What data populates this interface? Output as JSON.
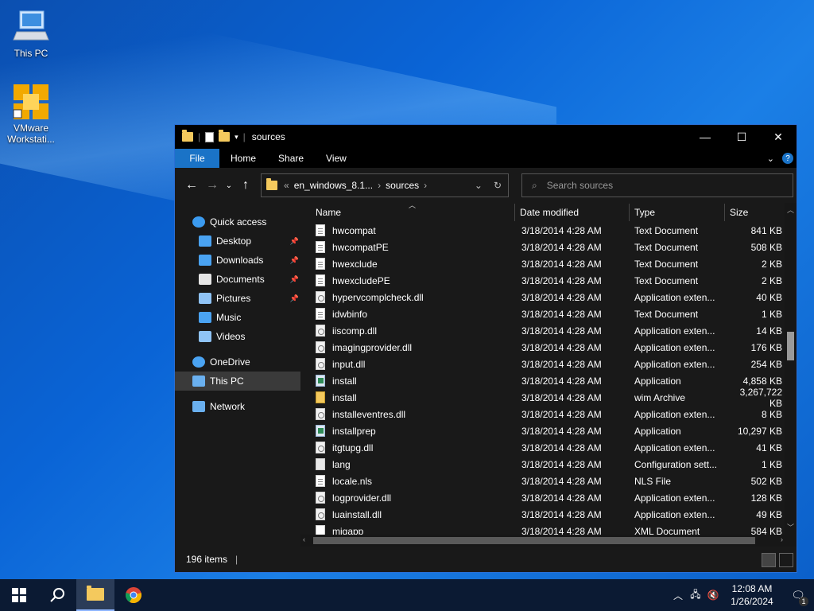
{
  "desktop": {
    "icons": [
      {
        "label": "This PC"
      },
      {
        "label": "VMware Workstati..."
      }
    ]
  },
  "window": {
    "title": "sources",
    "controls": {
      "minimize": "—",
      "maximize": "☐",
      "close": "✕"
    },
    "ribbon_tabs": [
      "File",
      "Home",
      "Share",
      "View"
    ],
    "help_label": "?",
    "address": {
      "parent": "en_windows_8.1...",
      "current": "sources",
      "prefix": "«"
    },
    "search": {
      "placeholder": "Search sources"
    },
    "nav": [
      {
        "label": "Quick access",
        "icon": "star-icon",
        "pinned": false
      },
      {
        "label": "Desktop",
        "icon": "desktop-icon",
        "pinned": true
      },
      {
        "label": "Downloads",
        "icon": "downloads-icon",
        "pinned": true
      },
      {
        "label": "Documents",
        "icon": "documents-icon",
        "pinned": true
      },
      {
        "label": "Pictures",
        "icon": "pictures-icon",
        "pinned": true
      },
      {
        "label": "Music",
        "icon": "music-icon",
        "pinned": false
      },
      {
        "label": "Videos",
        "icon": "videos-icon",
        "pinned": false
      },
      {
        "label": "OneDrive",
        "icon": "onedrive-icon",
        "pinned": false
      },
      {
        "label": "This PC",
        "icon": "computer-icon",
        "pinned": false
      },
      {
        "label": "Network",
        "icon": "network-icon",
        "pinned": false
      }
    ],
    "columns": {
      "name": "Name",
      "date": "Date modified",
      "type": "Type",
      "size": "Size"
    },
    "files": [
      {
        "name": "hwcompat",
        "date": "3/18/2014 4:28 AM",
        "type": "Text Document",
        "size": "841 KB",
        "icon": "txt"
      },
      {
        "name": "hwcompatPE",
        "date": "3/18/2014 4:28 AM",
        "type": "Text Document",
        "size": "508 KB",
        "icon": "txt"
      },
      {
        "name": "hwexclude",
        "date": "3/18/2014 4:28 AM",
        "type": "Text Document",
        "size": "2 KB",
        "icon": "txt"
      },
      {
        "name": "hwexcludePE",
        "date": "3/18/2014 4:28 AM",
        "type": "Text Document",
        "size": "2 KB",
        "icon": "txt"
      },
      {
        "name": "hypervcomplcheck.dll",
        "date": "3/18/2014 4:28 AM",
        "type": "Application exten...",
        "size": "40 KB",
        "icon": "dll"
      },
      {
        "name": "idwbinfo",
        "date": "3/18/2014 4:28 AM",
        "type": "Text Document",
        "size": "1 KB",
        "icon": "txt"
      },
      {
        "name": "iiscomp.dll",
        "date": "3/18/2014 4:28 AM",
        "type": "Application exten...",
        "size": "14 KB",
        "icon": "dll"
      },
      {
        "name": "imagingprovider.dll",
        "date": "3/18/2014 4:28 AM",
        "type": "Application exten...",
        "size": "176 KB",
        "icon": "dll"
      },
      {
        "name": "input.dll",
        "date": "3/18/2014 4:28 AM",
        "type": "Application exten...",
        "size": "254 KB",
        "icon": "dll"
      },
      {
        "name": "install",
        "date": "3/18/2014 4:28 AM",
        "type": "Application",
        "size": "4,858 KB",
        "icon": "app"
      },
      {
        "name": "install",
        "date": "3/18/2014 4:28 AM",
        "type": "wim Archive",
        "size": "3,267,722 KB",
        "icon": "wim"
      },
      {
        "name": "installeventres.dll",
        "date": "3/18/2014 4:28 AM",
        "type": "Application exten...",
        "size": "8 KB",
        "icon": "dll"
      },
      {
        "name": "installprep",
        "date": "3/18/2014 4:28 AM",
        "type": "Application",
        "size": "10,297 KB",
        "icon": "app"
      },
      {
        "name": "itgtupg.dll",
        "date": "3/18/2014 4:28 AM",
        "type": "Application exten...",
        "size": "41 KB",
        "icon": "dll"
      },
      {
        "name": "lang",
        "date": "3/18/2014 4:28 AM",
        "type": "Configuration sett...",
        "size": "1 KB",
        "icon": "cfg"
      },
      {
        "name": "locale.nls",
        "date": "3/18/2014 4:28 AM",
        "type": "NLS File",
        "size": "502 KB",
        "icon": "txt"
      },
      {
        "name": "logprovider.dll",
        "date": "3/18/2014 4:28 AM",
        "type": "Application exten...",
        "size": "128 KB",
        "icon": "dll"
      },
      {
        "name": "luainstall.dll",
        "date": "3/18/2014 4:28 AM",
        "type": "Application exten...",
        "size": "49 KB",
        "icon": "dll"
      },
      {
        "name": "migapp",
        "date": "3/18/2014 4:28 AM",
        "type": "XML Document",
        "size": "584 KB",
        "icon": "xml"
      }
    ],
    "status": {
      "item_count": "196 items"
    }
  },
  "taskbar": {
    "clock_time": "12:08 AM",
    "clock_date": "1/26/2024",
    "notification_count": "1"
  },
  "colors": {
    "accent": "#1a73c7",
    "window_bg": "#191919",
    "taskbar_bg": "#0b1a33"
  }
}
